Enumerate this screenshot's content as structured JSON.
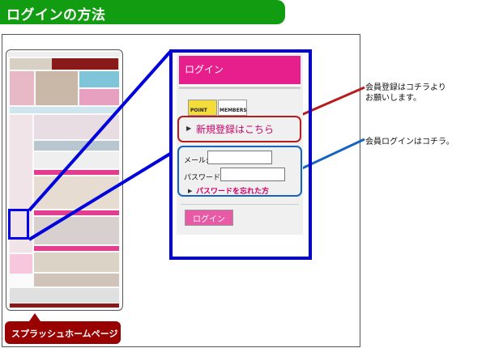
{
  "header": {
    "title": "ログインの方法"
  },
  "thumbnail": {
    "caption": "スプラッシュホームページ"
  },
  "login_panel": {
    "title": "ログイン",
    "badges": [
      "POINT",
      "MEMBERS"
    ],
    "register_link": "新規登録はこちら",
    "email_label": "メール:",
    "password_label": "パスワード:",
    "forgot_link": "パスワードを忘れた方",
    "login_button": "ログイン"
  },
  "annotations": {
    "register_note": "会員登録はコチラより\nお願いします。",
    "login_note": "会員ログインはコチラ。"
  },
  "colors": {
    "header_green": "#129c12",
    "highlight_blue": "#0000dd",
    "register_red": "#b71c1c",
    "login_blue": "#1565c0",
    "accent_pink": "#e61f8c",
    "caption_red": "#990000"
  },
  "icons": {
    "bullet_arrow": "▶"
  }
}
